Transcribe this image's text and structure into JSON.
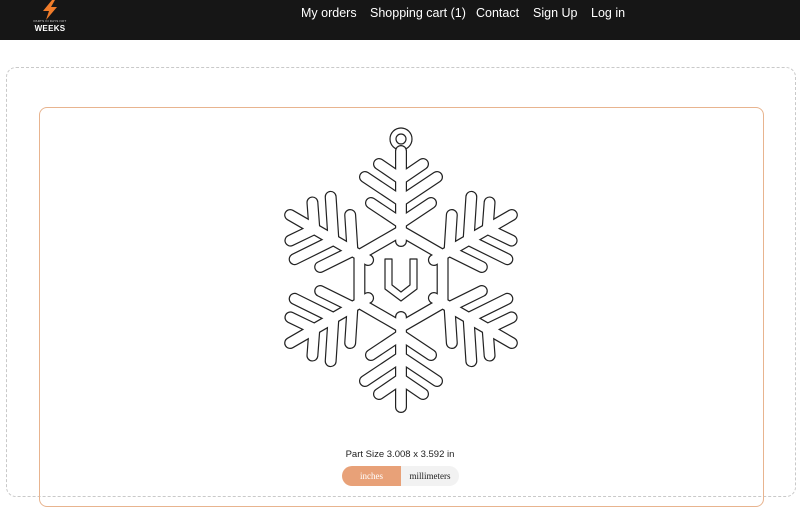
{
  "header": {
    "logo": {
      "icon": "lightning-bolt-icon",
      "tagline": "PARTS IN DAYS NOT",
      "wordmark": "WEEKS",
      "accent_color": "#f07c2a"
    },
    "nav": {
      "my_orders": "My orders",
      "cart": "Shopping cart (1)",
      "contact": "Contact",
      "sign_up": "Sign Up",
      "log_in": "Log in"
    }
  },
  "part": {
    "preview_icon": "snowflake-ornament-outline",
    "size_text": "Part Size 3.008 x 3.592 in",
    "units": {
      "inches": "inches",
      "millimeters": "millimeters",
      "selected": "inches"
    }
  },
  "colors": {
    "topbar": "#161616",
    "accent": "#e8a178",
    "frame_border": "#e8b48f"
  }
}
